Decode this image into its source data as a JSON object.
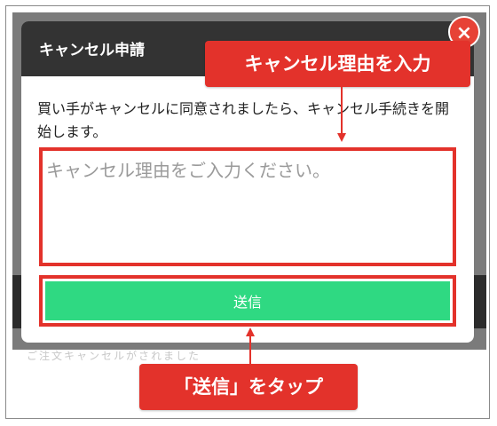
{
  "modal": {
    "title": "キャンセル申請",
    "close_icon_glyph": "×",
    "description": "買い手がキャンセルに同意されましたら、キャンセル手続きを開始します。",
    "reason_placeholder": "キャンセル理由をご入力ください。",
    "send_label": "送信"
  },
  "annotations": {
    "reason_callout": "キャンセル理由を入力",
    "send_callout": "「送信」をタップ"
  },
  "background": {
    "partial_text": "ご注文キャンセルがされました"
  },
  "colors": {
    "header_bg": "#333333",
    "accent_red": "#e3322b",
    "send_green": "#2fd982",
    "close_red": "#e74236"
  }
}
